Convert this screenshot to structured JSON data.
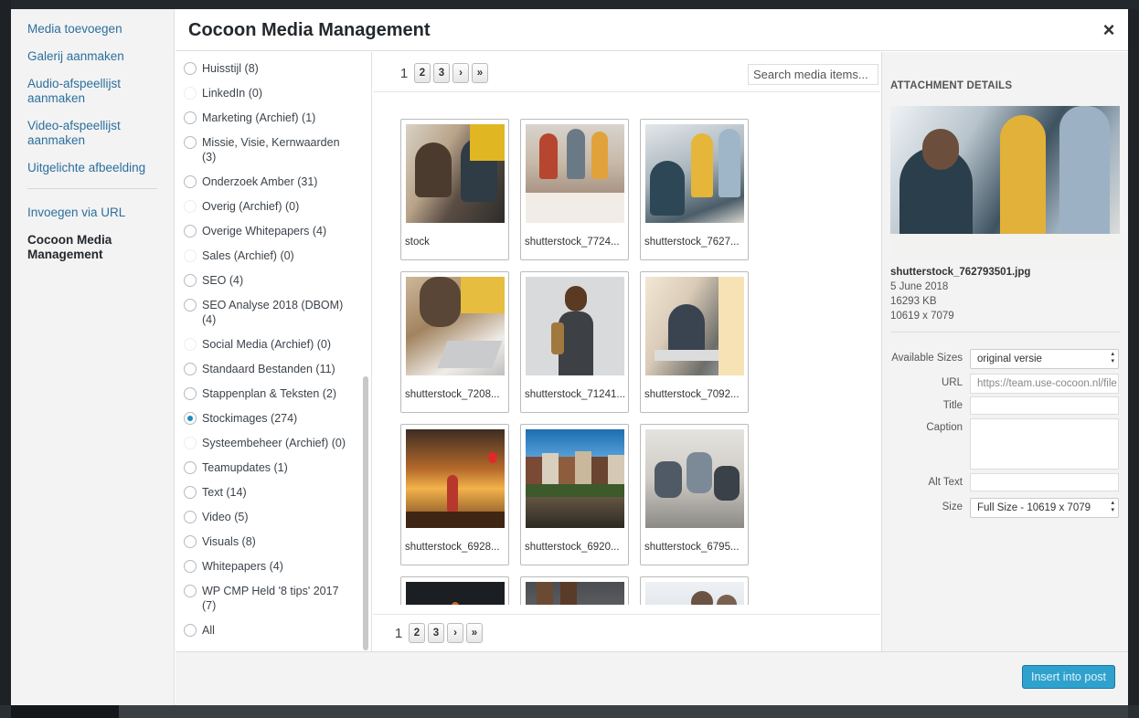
{
  "modal": {
    "title": "Cocoon Media Management",
    "close_glyph": "×"
  },
  "menu": {
    "items": [
      {
        "label": "Media toevoegen"
      },
      {
        "label": "Galerij aanmaken"
      },
      {
        "label": "Audio-afspeellijst aanmaken"
      },
      {
        "label": "Video-afspeellijst aanmaken"
      },
      {
        "label": "Uitgelichte afbeelding"
      }
    ],
    "items2": [
      {
        "label": "Invoegen via URL"
      },
      {
        "label": "Cocoon Media Management"
      }
    ]
  },
  "categories": [
    {
      "label": "Huisstijl (8)"
    },
    {
      "label": "LinkedIn (0)"
    },
    {
      "label": "Marketing (Archief) (1)"
    },
    {
      "label": "Missie, Visie, Kernwaarden (3)"
    },
    {
      "label": "Onderzoek Amber (31)"
    },
    {
      "label": "Overig (Archief) (0)"
    },
    {
      "label": "Overige Whitepapers (4)"
    },
    {
      "label": "Sales (Archief) (0)"
    },
    {
      "label": "SEO (4)"
    },
    {
      "label": "SEO Analyse 2018 (DBOM) (4)"
    },
    {
      "label": "Social Media (Archief) (0)"
    },
    {
      "label": "Standaard Bestanden (11)"
    },
    {
      "label": "Stappenplan & Teksten (2)"
    },
    {
      "label": "Stockimages (274)"
    },
    {
      "label": "Systeembeheer (Archief) (0)"
    },
    {
      "label": "Teamupdates (1)"
    },
    {
      "label": "Text (14)"
    },
    {
      "label": "Video (5)"
    },
    {
      "label": "Visuals (8)"
    },
    {
      "label": "Whitepapers (4)"
    },
    {
      "label": "WP CMP Held '8 tips' 2017 (7)"
    },
    {
      "label": "All"
    }
  ],
  "selected_category": "Stockimages (274)",
  "pagination": {
    "current": "1",
    "pages": [
      "2",
      "3"
    ],
    "next": "›",
    "last": "»"
  },
  "search": {
    "placeholder": "Search media items..."
  },
  "media": [
    {
      "name": "stock",
      "icon": "photo-men-tablet"
    },
    {
      "name": "shutterstock_7724...",
      "icon": "photo-team-table"
    },
    {
      "name": "shutterstock_7627...",
      "icon": "photo-office-meeting"
    },
    {
      "name": "shutterstock_7208...",
      "icon": "photo-laptop-work"
    },
    {
      "name": "shutterstock_71241...",
      "icon": "photo-woman-backpack"
    },
    {
      "name": "shutterstock_7092...",
      "icon": "photo-man-window"
    },
    {
      "name": "shutterstock_6928...",
      "icon": "photo-sunset-balloon"
    },
    {
      "name": "shutterstock_6920...",
      "icon": "photo-amsterdam-canal"
    },
    {
      "name": "shutterstock_6795...",
      "icon": "photo-office-chairs"
    },
    {
      "name": "",
      "icon": "photo-dark"
    },
    {
      "name": "",
      "icon": "photo-boots"
    },
    {
      "name": "",
      "icon": "photo-people"
    }
  ],
  "details": {
    "heading": "ATTACHMENT DETAILS",
    "filename": "shutterstock_762793501.jpg",
    "date": "5 June 2018",
    "filesize": "16293 KB",
    "dimensions": "10619 x 7079",
    "fields": {
      "available_sizes_label": "Available Sizes",
      "available_sizes_value": "original versie",
      "url_label": "URL",
      "url_value": "https://team.use-cocoon.nl/file",
      "title_label": "Title",
      "title_value": "",
      "caption_label": "Caption",
      "caption_value": "",
      "alt_label": "Alt Text",
      "alt_value": "",
      "size_label": "Size",
      "size_value": "Full Size - 10619 x 7079"
    }
  },
  "toolbar": {
    "insert_label": "Insert into post"
  },
  "colors": {
    "accent": "#2ea2cc",
    "link": "#2b6f9e",
    "admin_bar": "#23282d"
  }
}
